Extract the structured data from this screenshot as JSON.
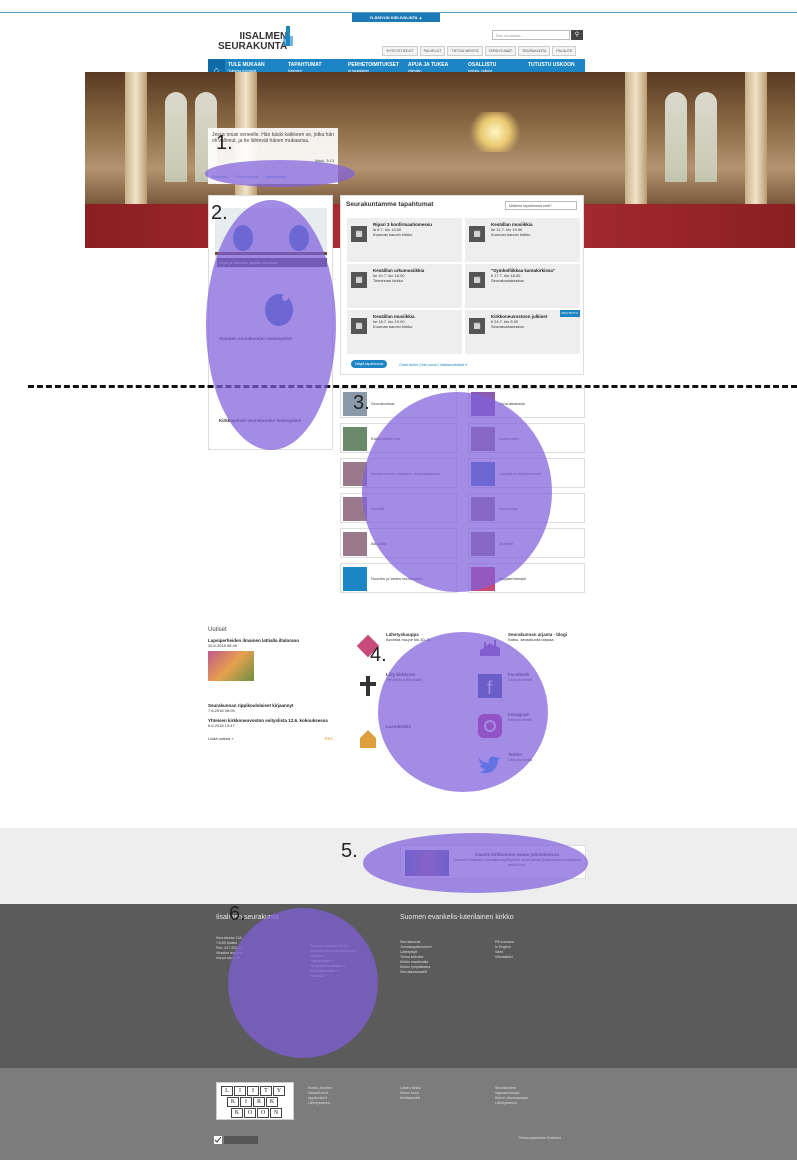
{
  "skip_link": "YLÄSIVUN KIELIVALINTA ▲",
  "logo": {
    "line1": "IISALMEN",
    "line2": "SEURAKUNTA"
  },
  "search": {
    "placeholder": "Etsi sivustolta..."
  },
  "top_links": [
    "YHTEYSTIEDOT",
    "PALVELUT",
    "TIETOA MEISTÄ",
    "TAPAHTUMAT",
    "SEURAKUNTA",
    "PALAUTE"
  ],
  "nav": {
    "items": [
      {
        "label": "TULE MUKAAN",
        "sub": "Toiminta ryhmissä"
      },
      {
        "label": "TAPAHTUMAT",
        "sub": "Kalenteri"
      },
      {
        "label": "PERHETOIMITUKSET",
        "sub": "ja hautajaiset"
      },
      {
        "label": "APUA JA TUKEA",
        "sub": "elämään"
      },
      {
        "label": "OSALLISTU",
        "sub": "lahjoita, vaikuta"
      },
      {
        "label": "TUTUSTU USKOON",
        "sub": ""
      }
    ]
  },
  "verse": {
    "text": "Jesus nousi veneelle. Hän käski kaikkeen se, jotka hän oli valinnut, ja he lähtevät hänen mukaansa.",
    "ref": "Mark. 3:13",
    "tabs": [
      "Raamattu",
      "Päivän rukous",
      "Ilmoitustaulu"
    ]
  },
  "events": {
    "title": "Seurakuntamme tapahtumat",
    "select": "Millaista tapahtumaa etsit?",
    "cards": [
      {
        "title": "Ripari 3 konfirmaatiomessu",
        "when": "la 8.7. klo 14.00",
        "place": "Kuuman kaunin kirkko"
      },
      {
        "title": "Kesäillan musiikkia",
        "when": "ke 11.7. klo 19.00",
        "place": "Kuuman kaunin kirkko"
      },
      {
        "title": "Kesäillan urkumusiikkia",
        "when": "ke 10.7. klo 18.00",
        "place": "Toiminnan kirkko"
      },
      {
        "title": "\"Symbolliikkaa kantakirkissa\"",
        "when": "ti 17.7. klo 18.00",
        "place": "Seurakuntakeskus"
      },
      {
        "title": "Kesäillan musiikkia",
        "when": "ke 18.7. klo 19.00",
        "place": "Kuuman kaunin kirkko"
      },
      {
        "title": "Kirkkoneuvostoon julkiset",
        "when": "ti 24.7. klo 8.30",
        "place": "Seurakuntakeskus",
        "tag": "MUUTETTU"
      }
    ],
    "button": "Näytä tapahtumat",
    "links": "Omat tiedot | Hae uusia | Vastaanottotilat ▾"
  },
  "teaser": {
    "caption1": "Kirjat ja tarinoita lapsille kirkossa",
    "caption2": "Suomen seurakuntien lastenpäivä",
    "caption3": "Kirkkopäivät seurakuntien lastenpäivä"
  },
  "tiles": [
    {
      "label": "Seurakuntasi",
      "icon": "church"
    },
    {
      "label": "Juna-aikataulu",
      "icon": "hash"
    },
    {
      "label": "Kaikki ikäryhmät",
      "icon": "people"
    },
    {
      "label": "Kuulumiset",
      "icon": "photo"
    },
    {
      "label": "Kastetoimitus, hautaus, huoltolaitoksen",
      "icon": "photo"
    },
    {
      "label": "Lapsille ja lapsiperheille",
      "icon": "kids"
    },
    {
      "label": "Nuorille",
      "icon": "photo"
    },
    {
      "label": "Nuorisotyö",
      "icon": "photo"
    },
    {
      "label": "Aikuisille",
      "icon": "photo"
    },
    {
      "label": "Musiikki",
      "icon": "photo"
    },
    {
      "label": "Nuorten ja lasten leiritoiminta",
      "icon": "cursor"
    },
    {
      "label": "Vapaaehtoistyö",
      "icon": "heart"
    }
  ],
  "news": {
    "heading": "Uutiset",
    "items": [
      {
        "title": "Lapsiperheiden ilmainen lattialla iltalorano",
        "date": "25.6.2018 08:49"
      },
      {
        "title": "Seurakunnan rippikoululaiset kirjaannyt",
        "date": "7.6.2018 08:05"
      },
      {
        "title": "Yhteisen kirkkoneuvoston esityslista 12.6. kokouksessa",
        "date": "6.6.2018 13:47"
      }
    ],
    "more": "Lisää uutisia »",
    "rss": "RSS"
  },
  "channels": [
    {
      "title": "Lähetyskauppa",
      "sub": "Avoinna ma-pe klo 10-16"
    },
    {
      "title": "Seurakunnan arjasta - blogi",
      "sub": "Katso, seurakunta tarjoaa"
    },
    {
      "title": "Liity kirkkoon",
      "sub": "Tervetuloa liittymään"
    },
    {
      "title": "Facebook",
      "sub": "Seuraa meitä"
    },
    {
      "title": "Instagram",
      "sub": "Seuraa meitä"
    },
    {
      "title": "Lasmkirkko",
      "sub": ""
    },
    {
      "title": "Twitter",
      "sub": "Seuraa meitä"
    }
  ],
  "banner": {
    "title": "Kaunis kirkkomme sanan julistuksessa",
    "text": "Suomen Iisalmen seurakuntayhtymän sivut sanan julistuksessa kirkossa yhteisöön."
  },
  "footer": {
    "left_title": "Iisalmen seurakunta",
    "right_title": "Suomen evankelis-luterilainen kirkko",
    "contact": [
      "Seurakunta 13A",
      "74100 Iisalmi",
      "Puh. 017 833 11",
      "Viraston avoinna",
      "ma-pe klo 9-15"
    ],
    "links1": [
      "Seurakuntavaalit 2018 »",
      "Yhteystiedot ja henkilökunta »",
      "Virastot »",
      "Tilavaraukset »",
      "Työpaikkailmoitukset »",
      "Rekisteriseloste »",
      "Hinnasto »"
    ],
    "links2": [
      "Seurakunnat",
      "Jumalanpalvelukset",
      "Lähetystyö",
      "Tietoa kirkosta",
      "Kirkko maailmalla",
      "Kirkko työpaikkana",
      "Seurakuntavaalit"
    ],
    "links3": [
      "På svenska",
      "In English",
      "Sámi",
      "Virtuaaliset"
    ]
  },
  "footer2": {
    "col1": [
      "Kirkko.Jorniten",
      "Sakasti.evl.fi",
      "rippikoulut.fi",
      "Lähetysseura"
    ],
    "col2": [
      "Lasten kirkko",
      "Kirkon kuva",
      "Mediapankki"
    ],
    "col3": [
      "Seurakuntien",
      "Vapaaehtoistyö",
      "Kirkon ulkomaanapu",
      "Lähetysseura"
    ],
    "bottom": "Tietosuojaseloste  Evästeet"
  },
  "annotations": [
    "1.",
    "2.",
    "3.",
    "4.",
    "5.",
    "6."
  ]
}
